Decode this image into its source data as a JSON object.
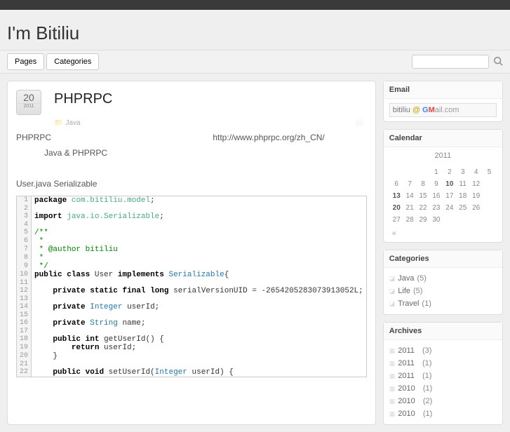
{
  "site_title": "I'm Bitiliu",
  "nav": {
    "pages": "Pages",
    "categories": "Categories"
  },
  "post": {
    "date_day": "20",
    "date_year": "2011",
    "title": "PHPRPC",
    "meta_category": "Java",
    "line1_a": "PHPRPC",
    "line1_b": "http://www.phprpc.org/zh_CN/",
    "line2": "Java  &  PHPRPC",
    "line3": "User.java      Serializable"
  },
  "code": [
    {
      "n": 1,
      "t": "<span class='kw'>package</span> <span class='pkg'>com.bitiliu.model</span>;"
    },
    {
      "n": 2,
      "t": ""
    },
    {
      "n": 3,
      "t": "<span class='kw'>import</span> <span class='pkg'>java.io.Serializable</span>;"
    },
    {
      "n": 4,
      "t": ""
    },
    {
      "n": 5,
      "t": "<span class='cmt'>/**</span>"
    },
    {
      "n": 6,
      "t": "<span class='cmt'> *</span>"
    },
    {
      "n": 7,
      "t": "<span class='cmt'> * @author bitiliu</span>"
    },
    {
      "n": 8,
      "t": "<span class='cmt'> *</span>"
    },
    {
      "n": 9,
      "t": "<span class='cmt'> */</span>"
    },
    {
      "n": 10,
      "t": "<span class='kw'>public</span> <span class='kw'>class</span> User <span class='kw'>implements</span> <span class='typ'>Serializable</span>{"
    },
    {
      "n": 11,
      "t": ""
    },
    {
      "n": 12,
      "t": "    <span class='kw'>private</span> <span class='kw'>static</span> <span class='kw'>final</span> <span class='kw'>long</span> serialVersionUID = -2654205283073913052L;"
    },
    {
      "n": 13,
      "t": ""
    },
    {
      "n": 14,
      "t": "    <span class='kw'>private</span> <span class='typ'>Integer</span> userId;"
    },
    {
      "n": 15,
      "t": ""
    },
    {
      "n": 16,
      "t": "    <span class='kw'>private</span> <span class='typ'>String</span> name;"
    },
    {
      "n": 17,
      "t": ""
    },
    {
      "n": 18,
      "t": "    <span class='kw'>public</span> <span class='kw'>int</span> getUserId() {"
    },
    {
      "n": 19,
      "t": "        <span class='kw'>return</span> userId;"
    },
    {
      "n": 20,
      "t": "    }"
    },
    {
      "n": 21,
      "t": ""
    },
    {
      "n": 22,
      "t": "    <span class='kw'>public</span> <span class='kw'>void</span> setUserId(<span class='typ'>Integer</span> userId) {"
    }
  ],
  "email": {
    "heading": "Email",
    "user": "bitiliu",
    "at": "@"
  },
  "calendar": {
    "heading": "Calendar",
    "title": "2011",
    "rows": [
      [
        "",
        "",
        "",
        "1",
        "2",
        "3",
        "4",
        "5"
      ],
      [
        "6",
        "7",
        "8",
        "9",
        "10",
        "11",
        "12"
      ],
      [
        "13",
        "14",
        "15",
        "16",
        "17",
        "18",
        "19"
      ],
      [
        "20",
        "21",
        "22",
        "23",
        "24",
        "25",
        "26"
      ],
      [
        "27",
        "28",
        "29",
        "30",
        "",
        "",
        ""
      ]
    ],
    "bold": [
      "10",
      "13",
      "20"
    ],
    "prev": "«"
  },
  "categories": {
    "heading": "Categories",
    "items": [
      {
        "label": "Java",
        "count": "(5)"
      },
      {
        "label": "Life",
        "count": "(5)"
      },
      {
        "label": "Travel",
        "count": "(1)"
      }
    ]
  },
  "archives": {
    "heading": "Archives",
    "items": [
      {
        "label": "2011",
        "count": "(3)"
      },
      {
        "label": "2011",
        "count": "(1)"
      },
      {
        "label": "2011",
        "count": "(1)"
      },
      {
        "label": "2010",
        "count": "(1)"
      },
      {
        "label": "2010",
        "count": "(2)"
      },
      {
        "label": "2010",
        "count": "(1)"
      }
    ]
  }
}
